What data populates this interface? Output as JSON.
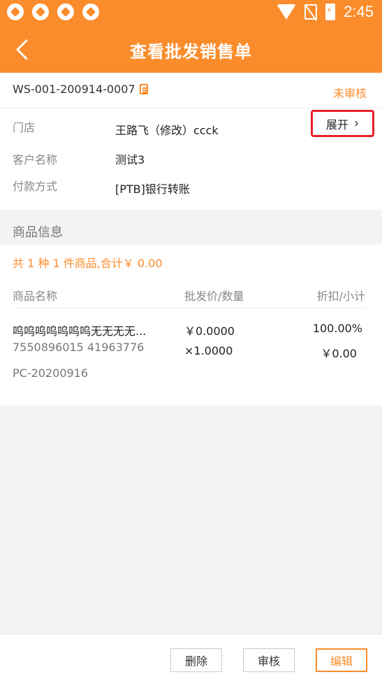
{
  "status_bar": {
    "time": "2:45"
  },
  "header": {
    "title": "查看批发销售单"
  },
  "order": {
    "number": "WS-001-200914-0007",
    "status": "未审核",
    "store_label": "门店",
    "store_value": "王路飞（修改）ccck",
    "expand_label": "展开",
    "customer_label": "客户名称",
    "customer_value": "测试3",
    "payment_label": "付款方式",
    "payment_value": "[PTB]银行转账"
  },
  "goods": {
    "section_title": "商品信息",
    "summary": "共 1 种 1 件商品,合计￥ 0.00",
    "columns": [
      "商品名称",
      "批发价/数量",
      "折扣/小计"
    ],
    "items": [
      {
        "name": "呜呜呜呜呜呜呜无无无无...",
        "barcode": "7550896015 41963776",
        "batch": "PC-20200916",
        "price": "￥0.0000",
        "qty": "×1.0000",
        "discount": "100.00%",
        "subtotal": "￥0.00"
      }
    ]
  },
  "actions": {
    "delete": "删除",
    "audit": "审核",
    "edit": "编辑"
  },
  "colors": {
    "accent": "#fb8c2b",
    "highlight_border": "#e8202a"
  }
}
